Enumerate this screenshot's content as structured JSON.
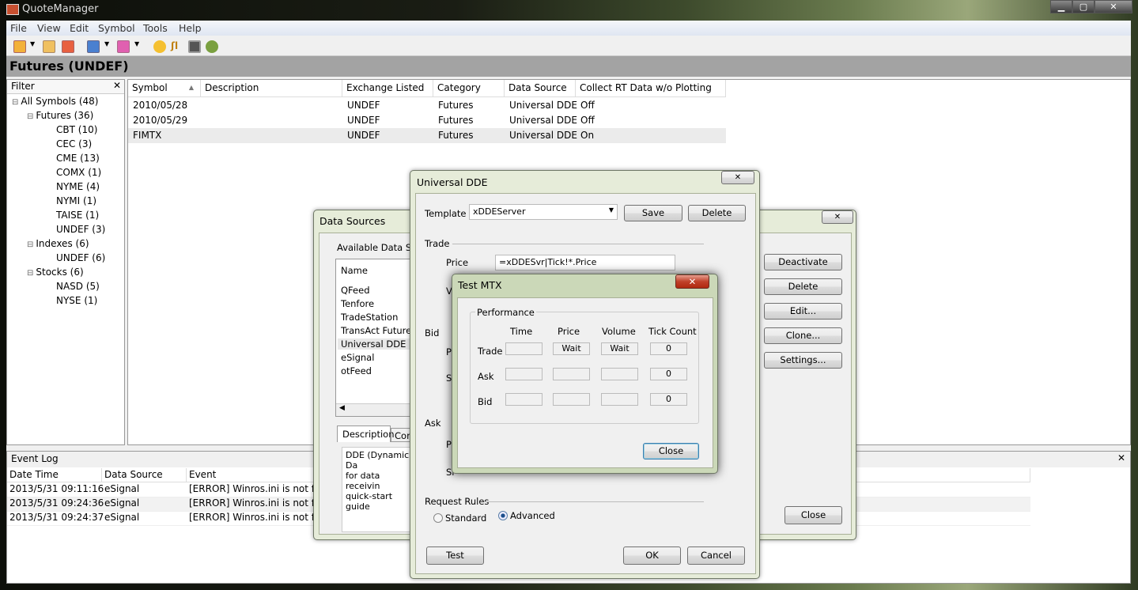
{
  "window": {
    "title": "QuoteManager",
    "minimize": "▁",
    "maximize": "▢",
    "close": "✕"
  },
  "menu": [
    "File",
    "View",
    "Edit",
    "Symbol",
    "Tools",
    "Help"
  ],
  "toolbar_icons": [
    "new-symbol-icon",
    "edit-symbol-icon",
    "delete-symbol-icon",
    "import-icon",
    "export-icon",
    "settings-sun-icon",
    "chart-icon",
    "calendar-icon",
    "plugin-icon"
  ],
  "header": {
    "title": "Futures (UNDEF)"
  },
  "filter": {
    "title": "Filter",
    "close": "✕",
    "tree": [
      {
        "label": "All Symbols (48)",
        "level": 0,
        "expander": "⊟"
      },
      {
        "label": "Futures (36)",
        "level": 1,
        "expander": "⊟"
      },
      {
        "label": "CBT (10)",
        "level": 2
      },
      {
        "label": "CEC (3)",
        "level": 2
      },
      {
        "label": "CME (13)",
        "level": 2
      },
      {
        "label": "COMX (1)",
        "level": 2
      },
      {
        "label": "NYME (4)",
        "level": 2
      },
      {
        "label": "NYMI (1)",
        "level": 2
      },
      {
        "label": "TAISE (1)",
        "level": 2
      },
      {
        "label": "UNDEF (3)",
        "level": 2
      },
      {
        "label": "Indexes (6)",
        "level": 1,
        "expander": "⊟"
      },
      {
        "label": "UNDEF (6)",
        "level": 2
      },
      {
        "label": "Stocks (6)",
        "level": 1,
        "expander": "⊟"
      },
      {
        "label": "NASD (5)",
        "level": 2
      },
      {
        "label": "NYSE (1)",
        "level": 2
      }
    ]
  },
  "symbols": {
    "columns": [
      "Symbol",
      "Description",
      "Exchange Listed",
      "Category",
      "Data Source",
      "Collect RT Data w/o Plotting"
    ],
    "sort_indicator": "▲",
    "rows": [
      [
        "2010/05/28",
        "",
        "UNDEF",
        "Futures",
        "Universal DDE",
        "Off"
      ],
      [
        "2010/05/29",
        "",
        "UNDEF",
        "Futures",
        "Universal DDE",
        "Off"
      ],
      [
        "FIMTX",
        "",
        "UNDEF",
        "Futures",
        "Universal DDE",
        "On"
      ]
    ]
  },
  "event_log": {
    "title": "Event Log",
    "close": "✕",
    "columns": [
      "Date Time",
      "Data Source",
      "Event"
    ],
    "rows": [
      [
        "2013/5/31  09:11:16",
        "eSignal",
        "[ERROR] Winros.ini is not fo"
      ],
      [
        "2013/5/31  09:24:36",
        "eSignal",
        "[ERROR] Winros.ini is not fo"
      ],
      [
        "2013/5/31  09:24:37",
        "eSignal",
        "[ERROR] Winros.ini is not fo"
      ]
    ]
  },
  "data_sources": {
    "title": "Data Sources",
    "close": "✕",
    "group": "Available Data Sour",
    "column": "Name",
    "items": [
      "QFeed",
      "Tenfore",
      "TradeStation",
      "TransAct Futures",
      "Universal DDE",
      "eSignal",
      "otFeed"
    ],
    "selected": "Universal DDE",
    "tabs": [
      "Description",
      "Conn"
    ],
    "description": [
      "DDE (Dynamic Da",
      "for data receivin",
      "quick-start guide"
    ],
    "buttons": [
      "Deactivate",
      "Delete",
      "Edit...",
      "Clone...",
      "Settings..."
    ],
    "close_button": "Close"
  },
  "universal_dde": {
    "title": "Universal DDE",
    "close": "✕",
    "template_label": "Template",
    "template_value": "xDDEServer",
    "save": "Save",
    "delete": "Delete",
    "trade_section": "Trade",
    "price_label": "Price",
    "price_value": "=xDDESvr|Tick!*.Price",
    "volume_label": "V",
    "bid_section": "Bid",
    "bid_price_label": "Pr",
    "bid_size_label": "Si",
    "ask_section": "Ask",
    "ask_price_label": "Pr",
    "ask_size_label": "Si",
    "request_rules": "Request Rules",
    "standard": "Standard",
    "advanced": "Advanced",
    "selected_rule": "Advanced",
    "test": "Test",
    "ok": "OK",
    "cancel": "Cancel"
  },
  "test_mtx": {
    "title": "Test MTX",
    "close": "✕",
    "group": "Performance",
    "columns": [
      "Time",
      "Price",
      "Volume",
      "Tick Count"
    ],
    "rows": [
      {
        "label": "Trade",
        "values": [
          "",
          "Wait",
          "Wait",
          "0"
        ]
      },
      {
        "label": "Ask",
        "values": [
          "",
          "",
          "",
          "0"
        ]
      },
      {
        "label": "Bid",
        "values": [
          "",
          "",
          "",
          "0"
        ]
      }
    ],
    "close_button": "Close"
  }
}
